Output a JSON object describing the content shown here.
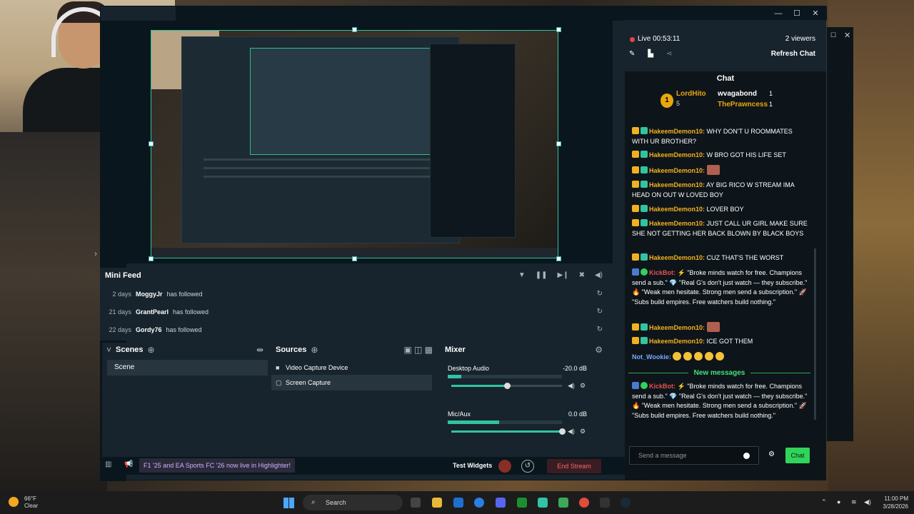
{
  "window": {
    "controls": [
      "—",
      "☐",
      "✕"
    ]
  },
  "preview": {
    "inner_stream_title": "Mini Feed"
  },
  "mini_feed": {
    "title": "Mini Feed",
    "rows": [
      {
        "age": "2 days",
        "user": "MoggyJr",
        "action": "has followed"
      },
      {
        "age": "21 days",
        "user": "GrantPearl",
        "action": "has followed"
      },
      {
        "age": "22 days",
        "user": "Gordy76",
        "action": "has followed"
      }
    ]
  },
  "scenes": {
    "title": "Scenes",
    "items": [
      "Scene"
    ]
  },
  "sources": {
    "title": "Sources",
    "items": [
      {
        "label": "Video Capture Device",
        "icon": "camera-icon"
      },
      {
        "label": "Screen Capture",
        "icon": "screen-capture-icon"
      }
    ]
  },
  "mixer": {
    "title": "Mixer",
    "channels": [
      {
        "name": "Desktop Audio",
        "db": "-20.0 dB",
        "meter": 0.12,
        "volume": 0.5
      },
      {
        "name": "Mic/Aux",
        "db": "0.0 dB",
        "meter": 0.45,
        "volume": 1.0
      }
    ]
  },
  "footer": {
    "banner": "F1 '25 and EA Sports FC '26 now live in Highlighter!",
    "test_widgets": "Test Widgets",
    "end_stream": "End Stream"
  },
  "chat": {
    "live": "Live 00:53:11",
    "viewers": "2 viewers",
    "refresh": "Refresh Chat",
    "header": "Chat",
    "leaderboard": {
      "rank": "1",
      "top_user": "LordHito",
      "top_count": "5",
      "second_user": "wvagabond",
      "second_count": "1",
      "third_user": "ThePrawncess",
      "third_count": "1"
    },
    "messages": [
      {
        "user": "HakeemDemon10:",
        "text": " WHY DON'T U ROOMMATES WITH UR BROTHER?"
      },
      {
        "user": "HakeemDemon10:",
        "text": " W BRO GOT HIS LIFE SET"
      },
      {
        "user": "HakeemDemon10:",
        "text": ""
      },
      {
        "user": "HakeemDemon10:",
        "text": " AY BIG RICO W STREAM IMA HEAD ON OUT W LOVED BOY"
      },
      {
        "user": "HakeemDemon10:",
        "text": " LOVER BOY"
      },
      {
        "user": "HakeemDemon10:",
        "text": " JUST CALL UR GIRL MAKE SURE SHE NOT GETTING HER BACK BLOWN BY BLACK BOYS"
      },
      {
        "user": "HakeemDemon10:",
        "text": " CUZ THAT'S THE WORST"
      },
      {
        "user": "KickBot:",
        "text": " ⚡ \"Broke minds watch for free. Champions send a sub.\" 💎 \"Real G's don't just watch — they subscribe.\" 🔥 \"Weak men hesitate. Strong men send a subscription.\" 🚀 \"Subs build empires. Free watchers build nothing.\""
      },
      {
        "user": "HakeemDemon10:",
        "text": ""
      },
      {
        "user": "HakeemDemon10:",
        "text": " ICE GOT THEM"
      },
      {
        "user": "Not_Wookie:",
        "text": ""
      }
    ],
    "new_messages": "New messages",
    "last_message": {
      "user": "KickBot:",
      "text": " ⚡ \"Broke minds watch for free. Champions send a sub.\" 💎 \"Real G's don't just watch — they subscribe.\" 🔥 \"Weak men hesitate. Strong men send a subscription.\" 🚀 \"Subs build empires. Free watchers build nothing.\""
    },
    "input_placeholder": "Send a message",
    "send": "Chat"
  },
  "taskbar": {
    "temp": "66°F",
    "weather": "Clear",
    "search": "Search",
    "time": "11:00 PM",
    "date": "3/28/2026"
  }
}
